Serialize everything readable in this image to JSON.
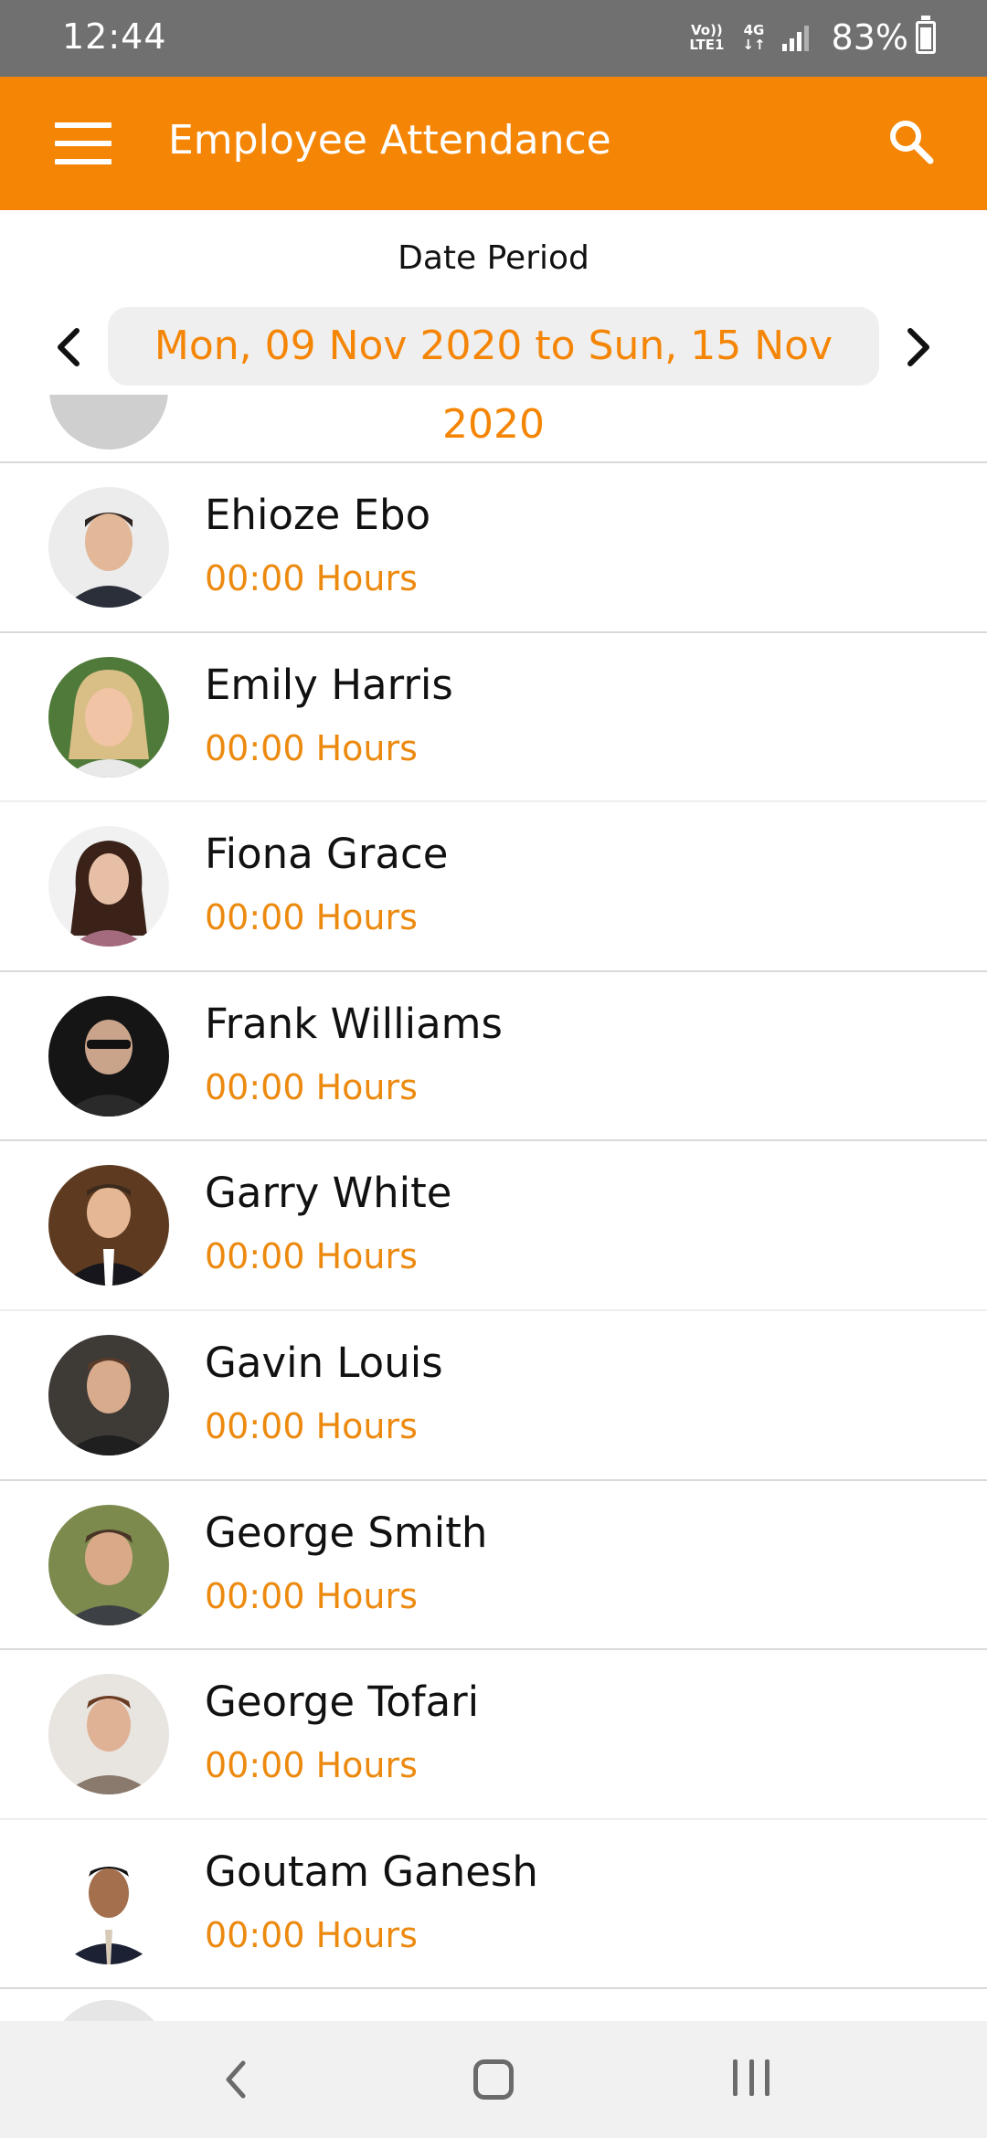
{
  "status_bar": {
    "time": "12:44",
    "volte_top": "Vo))",
    "volte_bottom": "LTE1",
    "network_type": "4G",
    "network_arrows": "↓↑",
    "battery_percent": "83%"
  },
  "app_bar": {
    "title": "Employee Attendance",
    "menu_icon": "hamburger-menu-icon",
    "search_icon": "search-icon",
    "background_color": "#f58505"
  },
  "date_period": {
    "label": "Date Period",
    "range": "Mon, 09 Nov 2020 to Sun, 15 Nov 2020",
    "prev_icon": "chevron-left-icon",
    "next_icon": "chevron-right-icon",
    "accent_color": "#f58505"
  },
  "employees": [
    {
      "name": "Ehioze Ebo",
      "hours": "00:00 Hours"
    },
    {
      "name": "Emily Harris",
      "hours": "00:00 Hours"
    },
    {
      "name": "Fiona Grace",
      "hours": "00:00 Hours"
    },
    {
      "name": "Frank Williams",
      "hours": "00:00 Hours"
    },
    {
      "name": "Garry White",
      "hours": "00:00 Hours"
    },
    {
      "name": "Gavin Louis",
      "hours": "00:00 Hours"
    },
    {
      "name": "George Smith",
      "hours": "00:00 Hours"
    },
    {
      "name": "George Tofari",
      "hours": "00:00 Hours"
    },
    {
      "name": "Goutam Ganesh",
      "hours": "00:00 Hours"
    }
  ],
  "nav_bar": {
    "back_icon": "back-chevron-icon",
    "home_icon": "home-square-icon",
    "recents_icon": "recents-bars-icon"
  }
}
